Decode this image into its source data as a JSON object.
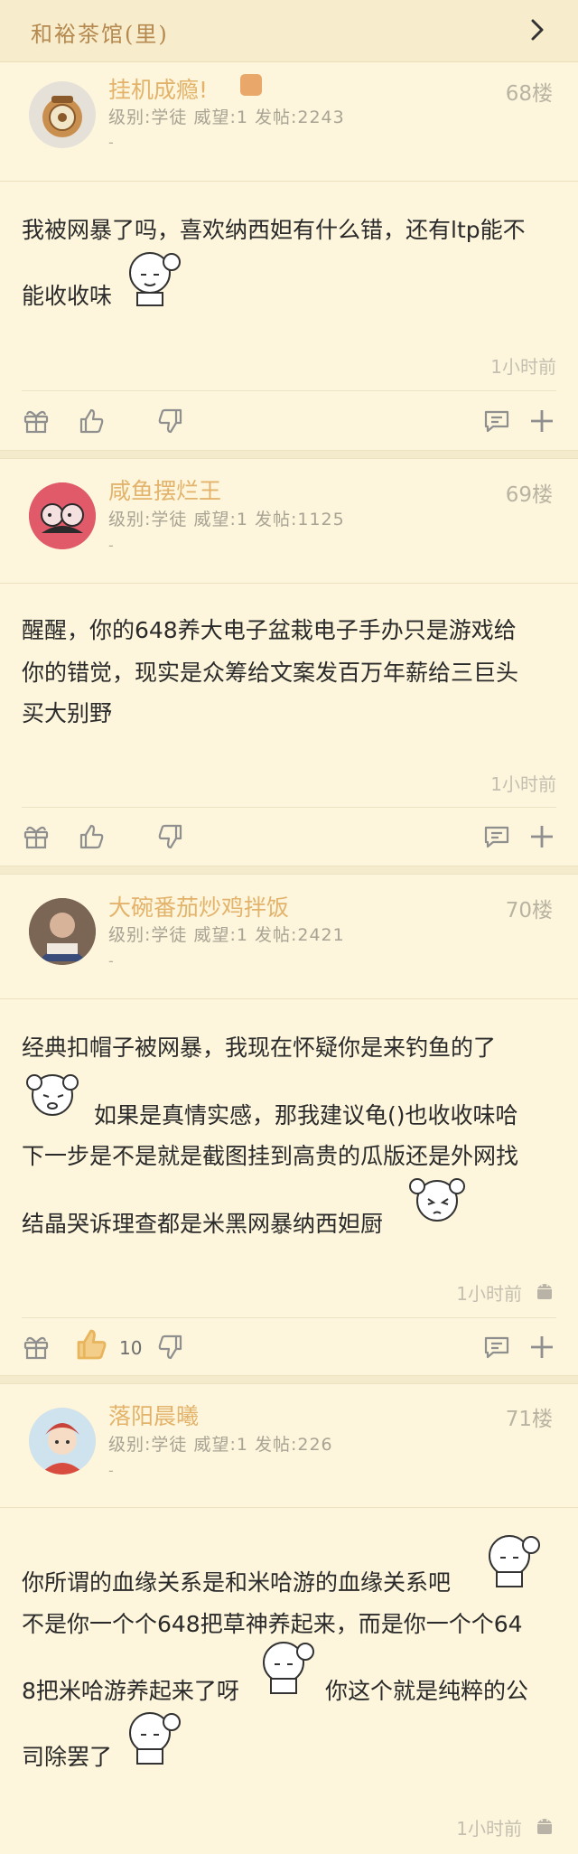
{
  "header": {
    "title": "和裕茶馆(里)"
  },
  "posts": [
    {
      "username": "挂机成瘾!",
      "floor": "68楼",
      "meta": "级别:学徒 威望:1 发帖:2243",
      "dash": "-",
      "lines": [
        "我被网暴了吗，喜欢纳西妲有什么错，还有ltp能不",
        "能收收味"
      ],
      "time": "1小时前",
      "likes": ""
    },
    {
      "username": "咸鱼摆烂王",
      "floor": "69楼",
      "meta": "级别:学徒 威望:1 发帖:1125",
      "dash": "-",
      "lines": [
        "醒醒，你的648养大电子盆栽电子手办只是游戏给",
        "你的错觉，现实是众筹给文案发百万年薪给三巨头",
        "买大别野"
      ],
      "time": "1小时前",
      "likes": ""
    },
    {
      "username": "大碗番茄炒鸡拌饭",
      "floor": "70楼",
      "meta": "级别:学徒 威望:1 发帖:2421",
      "dash": "-",
      "lines": [
        "经典扣帽子被网暴，我现在怀疑你是来钓鱼的了",
        "如果是真情实感，那我建议龟()也收收味哈",
        "下一步是不是就是截图挂到高贵的瓜版还是外网找",
        "结晶哭诉理查都是米黑网暴纳西妲厨"
      ],
      "time": "1小时前",
      "likes": "10"
    },
    {
      "username": "落阳晨曦",
      "floor": "71楼",
      "meta": "级别:学徒 威望:1 发帖:226",
      "dash": "-",
      "lines": [
        "你所谓的血缘关系是和米哈游的血缘关系吧",
        "不是你一个个648把草神养起来，而是你一个个64",
        "8把米哈游养起来了呀",
        "你这个就是纯粹的公",
        "司除罢了"
      ],
      "time": "1小时前",
      "likes": ""
    }
  ],
  "colors": {
    "accent": "#e3b36b",
    "like_active": "#e8b45c",
    "background": "#fdf6dc"
  }
}
